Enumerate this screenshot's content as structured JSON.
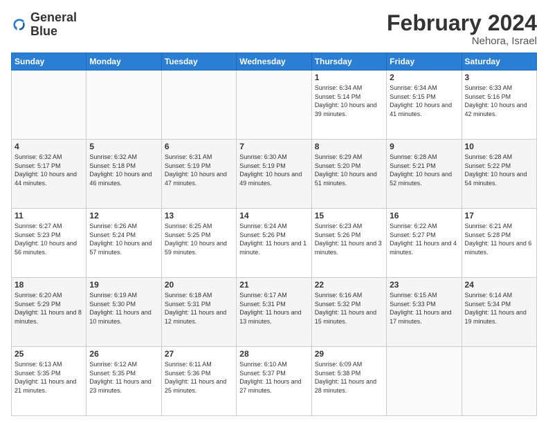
{
  "logo": {
    "line1": "General",
    "line2": "Blue"
  },
  "header": {
    "title": "February 2024",
    "subtitle": "Nehora, Israel"
  },
  "weekdays": [
    "Sunday",
    "Monday",
    "Tuesday",
    "Wednesday",
    "Thursday",
    "Friday",
    "Saturday"
  ],
  "weeks": [
    [
      {
        "day": "",
        "info": ""
      },
      {
        "day": "",
        "info": ""
      },
      {
        "day": "",
        "info": ""
      },
      {
        "day": "",
        "info": ""
      },
      {
        "day": "1",
        "info": "Sunrise: 6:34 AM\nSunset: 5:14 PM\nDaylight: 10 hours\nand 39 minutes."
      },
      {
        "day": "2",
        "info": "Sunrise: 6:34 AM\nSunset: 5:15 PM\nDaylight: 10 hours\nand 41 minutes."
      },
      {
        "day": "3",
        "info": "Sunrise: 6:33 AM\nSunset: 5:16 PM\nDaylight: 10 hours\nand 42 minutes."
      }
    ],
    [
      {
        "day": "4",
        "info": "Sunrise: 6:32 AM\nSunset: 5:17 PM\nDaylight: 10 hours\nand 44 minutes."
      },
      {
        "day": "5",
        "info": "Sunrise: 6:32 AM\nSunset: 5:18 PM\nDaylight: 10 hours\nand 46 minutes."
      },
      {
        "day": "6",
        "info": "Sunrise: 6:31 AM\nSunset: 5:19 PM\nDaylight: 10 hours\nand 47 minutes."
      },
      {
        "day": "7",
        "info": "Sunrise: 6:30 AM\nSunset: 5:19 PM\nDaylight: 10 hours\nand 49 minutes."
      },
      {
        "day": "8",
        "info": "Sunrise: 6:29 AM\nSunset: 5:20 PM\nDaylight: 10 hours\nand 51 minutes."
      },
      {
        "day": "9",
        "info": "Sunrise: 6:28 AM\nSunset: 5:21 PM\nDaylight: 10 hours\nand 52 minutes."
      },
      {
        "day": "10",
        "info": "Sunrise: 6:28 AM\nSunset: 5:22 PM\nDaylight: 10 hours\nand 54 minutes."
      }
    ],
    [
      {
        "day": "11",
        "info": "Sunrise: 6:27 AM\nSunset: 5:23 PM\nDaylight: 10 hours\nand 56 minutes."
      },
      {
        "day": "12",
        "info": "Sunrise: 6:26 AM\nSunset: 5:24 PM\nDaylight: 10 hours\nand 57 minutes."
      },
      {
        "day": "13",
        "info": "Sunrise: 6:25 AM\nSunset: 5:25 PM\nDaylight: 10 hours\nand 59 minutes."
      },
      {
        "day": "14",
        "info": "Sunrise: 6:24 AM\nSunset: 5:26 PM\nDaylight: 11 hours\nand 1 minute."
      },
      {
        "day": "15",
        "info": "Sunrise: 6:23 AM\nSunset: 5:26 PM\nDaylight: 11 hours\nand 3 minutes."
      },
      {
        "day": "16",
        "info": "Sunrise: 6:22 AM\nSunset: 5:27 PM\nDaylight: 11 hours\nand 4 minutes."
      },
      {
        "day": "17",
        "info": "Sunrise: 6:21 AM\nSunset: 5:28 PM\nDaylight: 11 hours\nand 6 minutes."
      }
    ],
    [
      {
        "day": "18",
        "info": "Sunrise: 6:20 AM\nSunset: 5:29 PM\nDaylight: 11 hours\nand 8 minutes."
      },
      {
        "day": "19",
        "info": "Sunrise: 6:19 AM\nSunset: 5:30 PM\nDaylight: 11 hours\nand 10 minutes."
      },
      {
        "day": "20",
        "info": "Sunrise: 6:18 AM\nSunset: 5:31 PM\nDaylight: 11 hours\nand 12 minutes."
      },
      {
        "day": "21",
        "info": "Sunrise: 6:17 AM\nSunset: 5:31 PM\nDaylight: 11 hours\nand 13 minutes."
      },
      {
        "day": "22",
        "info": "Sunrise: 6:16 AM\nSunset: 5:32 PM\nDaylight: 11 hours\nand 15 minutes."
      },
      {
        "day": "23",
        "info": "Sunrise: 6:15 AM\nSunset: 5:33 PM\nDaylight: 11 hours\nand 17 minutes."
      },
      {
        "day": "24",
        "info": "Sunrise: 6:14 AM\nSunset: 5:34 PM\nDaylight: 11 hours\nand 19 minutes."
      }
    ],
    [
      {
        "day": "25",
        "info": "Sunrise: 6:13 AM\nSunset: 5:35 PM\nDaylight: 11 hours\nand 21 minutes."
      },
      {
        "day": "26",
        "info": "Sunrise: 6:12 AM\nSunset: 5:35 PM\nDaylight: 11 hours\nand 23 minutes."
      },
      {
        "day": "27",
        "info": "Sunrise: 6:11 AM\nSunset: 5:36 PM\nDaylight: 11 hours\nand 25 minutes."
      },
      {
        "day": "28",
        "info": "Sunrise: 6:10 AM\nSunset: 5:37 PM\nDaylight: 11 hours\nand 27 minutes."
      },
      {
        "day": "29",
        "info": "Sunrise: 6:09 AM\nSunset: 5:38 PM\nDaylight: 11 hours\nand 28 minutes."
      },
      {
        "day": "",
        "info": ""
      },
      {
        "day": "",
        "info": ""
      }
    ]
  ]
}
